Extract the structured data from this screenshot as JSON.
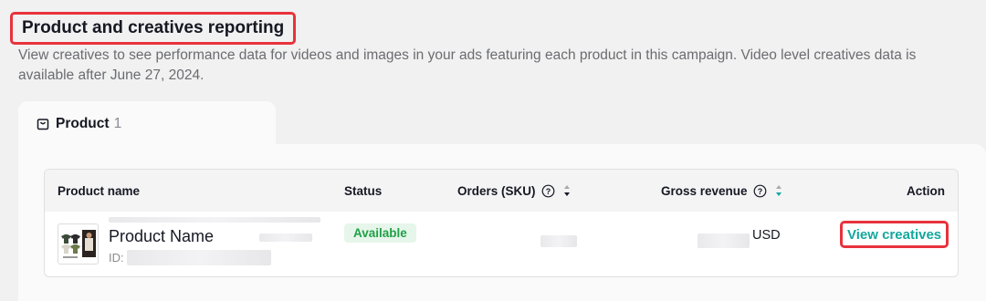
{
  "section": {
    "title": "Product and creatives reporting",
    "description": "View creatives to see performance data for videos and images in your ads featuring each product in this campaign. Video level creatives data is available after June 27, 2024."
  },
  "tabs": [
    {
      "label": "Product",
      "count": "1",
      "icon": "shopping-bag-icon"
    }
  ],
  "table": {
    "columns": {
      "product_name": "Product name",
      "status": "Status",
      "orders": "Orders (SKU)",
      "gross_revenue": "Gross revenue",
      "action": "Action"
    },
    "rows": [
      {
        "product_name": "Product Name",
        "id_label": "ID:",
        "status": "Available",
        "gross_revenue_currency": "USD",
        "action": "View creatives"
      }
    ]
  },
  "colors": {
    "highlight_border": "#e8323c",
    "accent_teal": "#13a89e",
    "status_green": "#21a047",
    "status_bg": "#e6f6ea"
  }
}
